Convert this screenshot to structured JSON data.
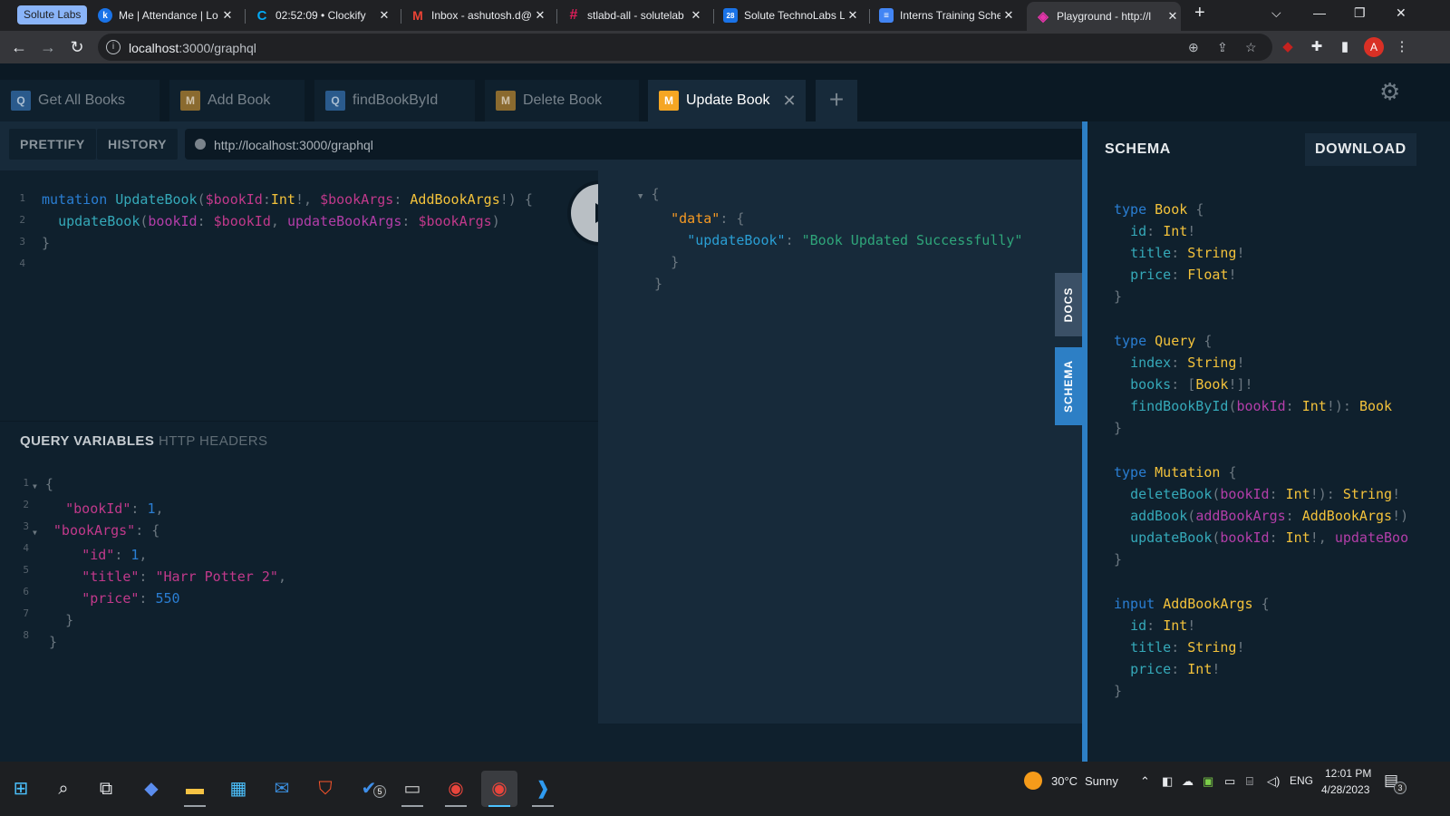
{
  "browser": {
    "tab_group": "Solute Labs",
    "tabs": [
      {
        "title": "Me | Attendance | Lo",
        "fav": "k",
        "fav_color": "#1a73e8"
      },
      {
        "title": "02:52:09 • Clockify",
        "fav": "C",
        "fav_color": "#03a9f4"
      },
      {
        "title": "Inbox - ashutosh.d@",
        "fav": "M",
        "fav_color": "#ea4335"
      },
      {
        "title": "stlabd-all - solutelab",
        "fav": "#",
        "fav_color": "#4a154b"
      },
      {
        "title": "Solute TechnoLabs LL",
        "fav": "28",
        "fav_color": "#1a73e8"
      },
      {
        "title": "Interns Training Sche",
        "fav": "≡",
        "fav_color": "#4285f4"
      },
      {
        "title": "Playground - http://l",
        "fav": "◈",
        "fav_color": "#e535ab"
      }
    ],
    "url_host": "localhost",
    "url_rest": ":3000/graphql",
    "profile_initial": "A"
  },
  "playground": {
    "query_tabs": [
      {
        "badge": "Q",
        "label": "Get All Books"
      },
      {
        "badge": "M",
        "label": "Add Book"
      },
      {
        "badge": "Q",
        "label": "findBookById"
      },
      {
        "badge": "M",
        "label": "Delete Book"
      },
      {
        "badge": "M",
        "label": "Update Book"
      }
    ],
    "prettify_label": "PRETTIFY",
    "history_label": "HISTORY",
    "endpoint": "http://localhost:3000/graphql",
    "query_line_numbers": [
      "1",
      "2",
      "3",
      "4"
    ],
    "query": {
      "kw_mutation": "mutation",
      "op_name": "UpdateBook",
      "var1": "$bookId",
      "type1": "Int",
      "var2": "$bookArgs",
      "type2": "AddBookArgs",
      "field": "updateBook",
      "arg1": "bookId",
      "arg2": "updateBookArgs"
    },
    "variables_tab_label": "QUERY VARIABLES",
    "headers_tab_label": "HTTP HEADERS",
    "variables_line_numbers": [
      "1",
      "2",
      "3",
      "4",
      "5",
      "6",
      "7",
      "8"
    ],
    "variables": {
      "bookId_key": "\"bookId\"",
      "bookId_val": "1",
      "bookArgs_key": "\"bookArgs\"",
      "id_key": "\"id\"",
      "id_val": "1",
      "title_key": "\"title\"",
      "title_val": "\"Harr Potter 2\"",
      "price_key": "\"price\"",
      "price_val": "550"
    },
    "result": {
      "data_key": "\"data\"",
      "update_key": "\"updateBook\"",
      "update_val": "\"Book Updated Successfully\""
    },
    "side_tabs": {
      "docs": "DOCS",
      "schema": "SCHEMA"
    },
    "schema_panel": {
      "title": "SCHEMA",
      "download_label": "DOWNLOAD",
      "types": {
        "book": {
          "kw": "type",
          "name": "Book",
          "fields": [
            [
              "id",
              "Int"
            ],
            [
              "title",
              "String"
            ],
            [
              "price",
              "Float"
            ]
          ]
        },
        "query": {
          "kw": "type",
          "name": "Query"
        },
        "mutation": {
          "kw": "type",
          "name": "Mutation"
        },
        "input": {
          "kw": "input",
          "name": "AddBookArgs",
          "fields": [
            [
              "id",
              "Int"
            ],
            [
              "title",
              "String"
            ],
            [
              "price",
              "Int"
            ]
          ]
        }
      },
      "query_fields": {
        "index": "index",
        "index_type": "String",
        "books": "books",
        "books_type": "Book",
        "find": "findBookById",
        "find_arg": "bookId",
        "find_arg_type": "Int",
        "find_type": "Book"
      },
      "mutation_fields": {
        "delete": "deleteBook",
        "delete_arg": "bookId",
        "delete_arg_type": "Int",
        "delete_type": "String",
        "add": "addBook",
        "add_arg": "addBookArgs",
        "add_arg_type": "AddBookArgs",
        "update": "updateBook",
        "update_arg": "bookId",
        "update_arg_type": "Int",
        "update_arg2": "updateBoo"
      }
    }
  },
  "taskbar": {
    "weather_temp": "30°C",
    "weather_desc": "Sunny",
    "lang": "ENG",
    "time": "12:01 PM",
    "date": "4/28/2023",
    "todo_badge": "5",
    "notif_badge": "3"
  },
  "colors": {
    "accent_blue": "#2d7fc5",
    "mutation_orange": "#f5a623",
    "query_blue": "#2a5a8c"
  }
}
